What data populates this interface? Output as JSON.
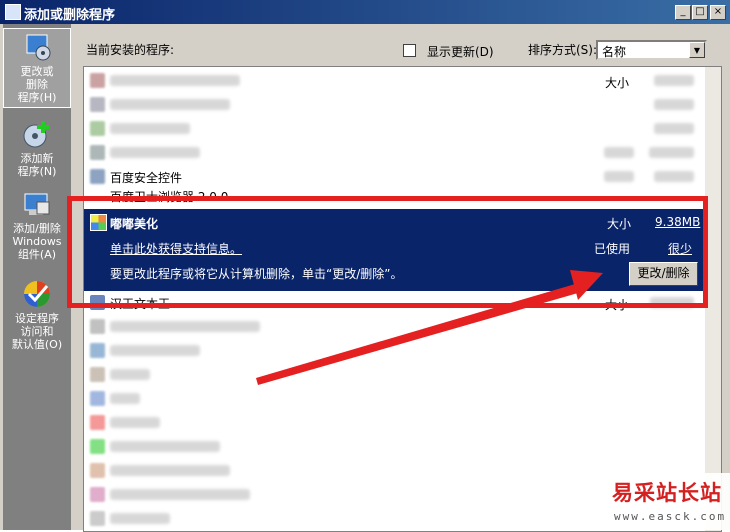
{
  "window": {
    "title": "添加或删除程序"
  },
  "titlebar_buttons": {
    "minimize": "_",
    "maximize": "□",
    "close": "×"
  },
  "sidebar": {
    "items": [
      {
        "label": "更改或\n删除\n程序(H)",
        "icon": "change-remove-programs-icon",
        "active": true
      },
      {
        "label": "添加新\n程序(N)",
        "icon": "add-new-program-icon",
        "active": false
      },
      {
        "label": "添加/删除\nWindows\n组件(A)",
        "icon": "windows-components-icon",
        "active": false
      },
      {
        "label": "设定程序\n访问和\n默认值(O)",
        "icon": "program-access-icon",
        "active": false
      }
    ]
  },
  "header": {
    "installed_label": "当前安装的程序:",
    "show_updates_label": "显示更新(D)",
    "show_updates_checked": false,
    "sort_label": "排序方式(S):",
    "sort_value": "名称"
  },
  "list": {
    "visible_rows": [
      {
        "text": "",
        "right": "大小"
      },
      {
        "text": "百度安全控件",
        "right": ""
      },
      {
        "text": "百度卫士浏览器 2.0.0",
        "right": ""
      },
      {
        "text": "汉王文本王",
        "right": "大小"
      }
    ],
    "selected": {
      "name": "嘟嘟美化",
      "size_label": "大小",
      "size_value": "9.38MB",
      "support_link": "单击此处获得支持信息。",
      "used_label": "已使用",
      "used_value": "很少",
      "description": "要更改此程序或将它从计算机删除，单击“更改/删除”。",
      "change_remove_button": "更改/删除"
    }
  },
  "watermark": {
    "main": "易采站长站",
    "sub": "www.easck.com"
  },
  "colors": {
    "selection": "#0a246a",
    "annotation": "#e52020",
    "titlebar": "#0a246a"
  }
}
